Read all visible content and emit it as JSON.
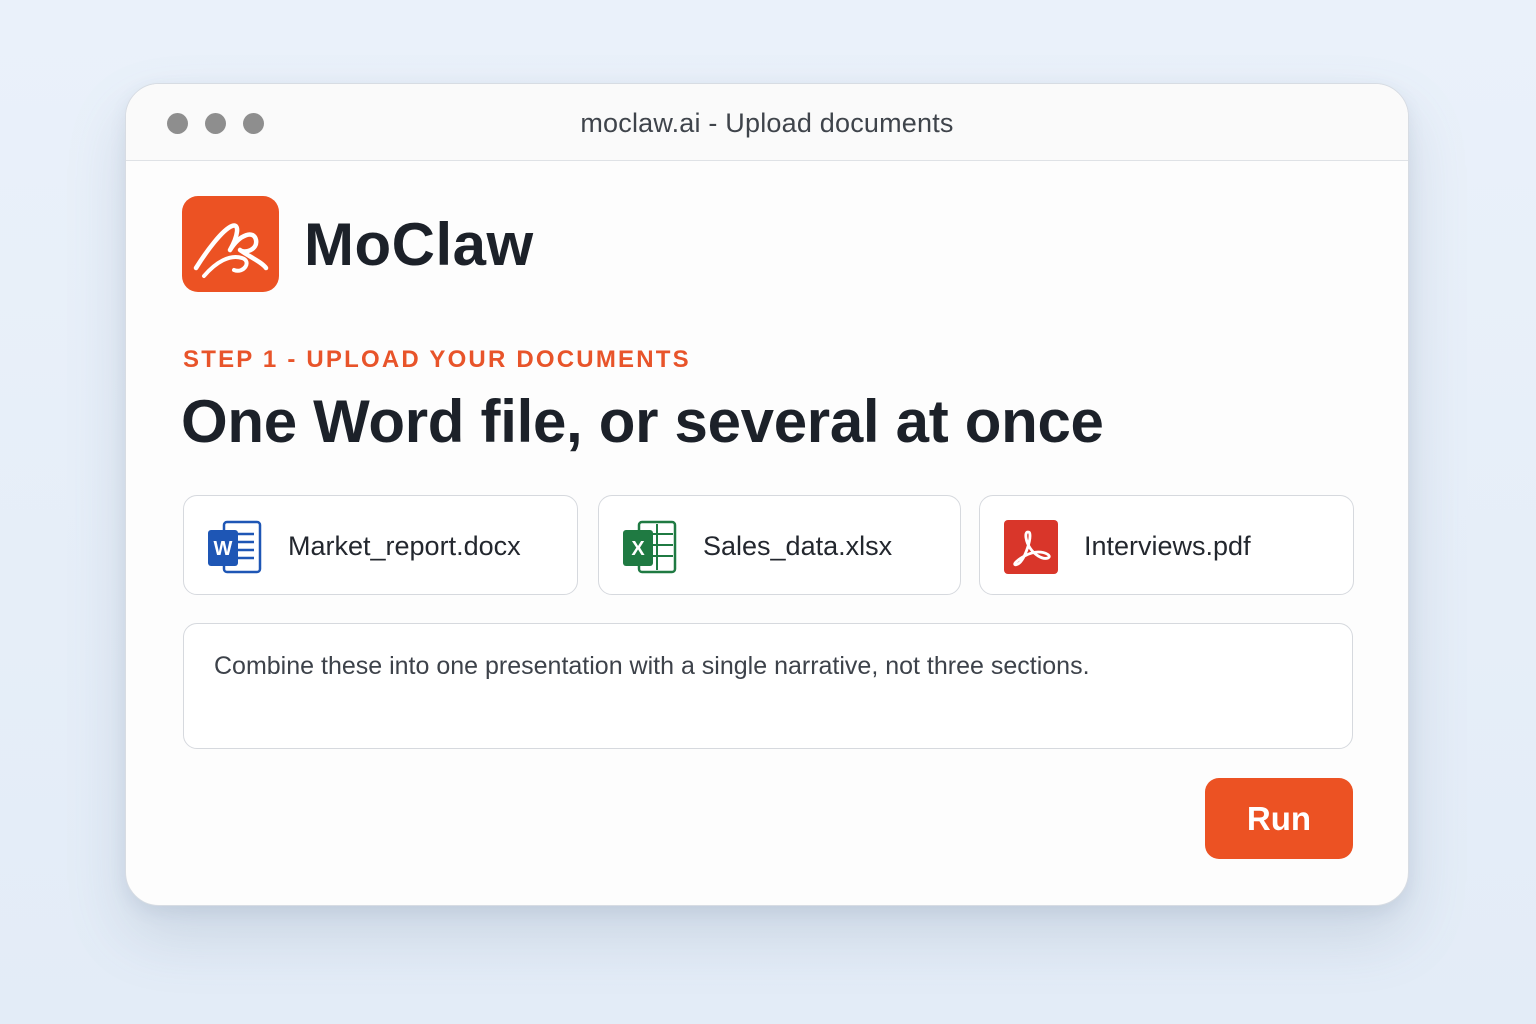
{
  "window": {
    "title": "moclaw.ai - Upload documents"
  },
  "brand": {
    "name": "MoClaw",
    "logo_icon": "moclaw-signature-logo",
    "accent_color": "#ec5223"
  },
  "step": {
    "label": "STEP 1 - UPLOAD YOUR DOCUMENTS",
    "headline": "One Word file, or several at once"
  },
  "files": [
    {
      "name": "Market_report.docx",
      "icon": "word-icon",
      "color": "#1e56b5"
    },
    {
      "name": "Sales_data.xlsx",
      "icon": "excel-icon",
      "color": "#1f7a42"
    },
    {
      "name": "Interviews.pdf",
      "icon": "pdf-icon",
      "color": "#d9362a"
    }
  ],
  "prompt": {
    "value": "Combine these into one presentation with a single narrative, not three sections."
  },
  "actions": {
    "run_label": "Run"
  }
}
